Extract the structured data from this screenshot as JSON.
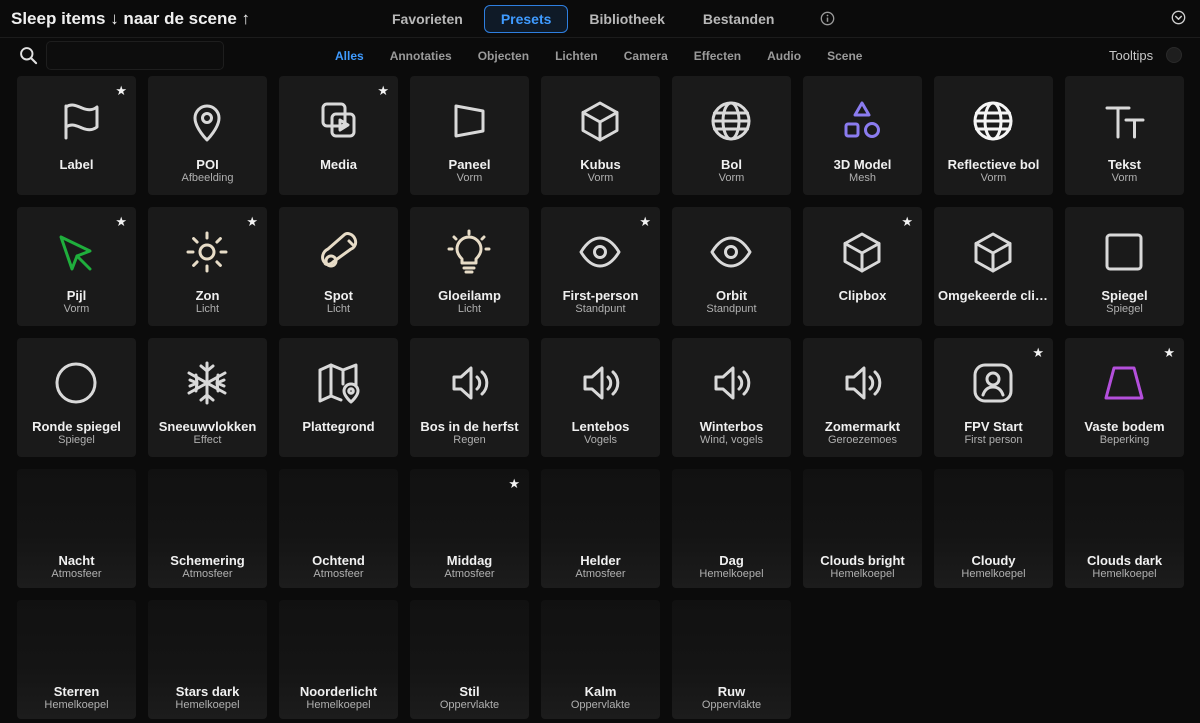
{
  "header": {
    "title": "Sleep items ↓ naar de scene ↑",
    "tabs": [
      {
        "label": "Favorieten",
        "active": false
      },
      {
        "label": "Presets",
        "active": true
      },
      {
        "label": "Bibliotheek",
        "active": false
      },
      {
        "label": "Bestanden",
        "active": false
      }
    ]
  },
  "search": {
    "value": "",
    "placeholder": ""
  },
  "filters": [
    {
      "label": "Alles",
      "active": true
    },
    {
      "label": "Annotaties",
      "active": false
    },
    {
      "label": "Objecten",
      "active": false
    },
    {
      "label": "Lichten",
      "active": false
    },
    {
      "label": "Camera",
      "active": false
    },
    {
      "label": "Effecten",
      "active": false
    },
    {
      "label": "Audio",
      "active": false
    },
    {
      "label": "Scene",
      "active": false
    }
  ],
  "tooltips": {
    "label": "Tooltips",
    "enabled": false
  },
  "colors": {
    "accent": "#3f9bff",
    "icon": "#d9d9d9",
    "purple": "#8b7cf0",
    "green": "#1fae3c",
    "beige": "#e7dcc7",
    "magenta": "#b44fdc"
  },
  "presets": [
    {
      "name": "Label",
      "sub": "",
      "icon": "flag-icon",
      "color": "#d9d9d9",
      "star": true
    },
    {
      "name": "POI",
      "sub": "Afbeelding",
      "icon": "map-pin-icon",
      "color": "#d9d9d9",
      "star": false
    },
    {
      "name": "Media",
      "sub": "",
      "icon": "media-icon",
      "color": "#d9d9d9",
      "star": true
    },
    {
      "name": "Paneel",
      "sub": "Vorm",
      "icon": "panel-icon",
      "color": "#d9d9d9",
      "star": false
    },
    {
      "name": "Kubus",
      "sub": "Vorm",
      "icon": "cube-icon",
      "color": "#d9d9d9",
      "star": false
    },
    {
      "name": "Bol",
      "sub": "Vorm",
      "icon": "globe-icon",
      "color": "#d9d9d9",
      "star": false
    },
    {
      "name": "3D Model",
      "sub": "Mesh",
      "icon": "shapes-icon",
      "color": "#8b7cf0",
      "star": false
    },
    {
      "name": "Reflectieve bol",
      "sub": "Vorm",
      "icon": "globe-icon",
      "color": "#f5f5f5",
      "star": false
    },
    {
      "name": "Tekst",
      "sub": "Vorm",
      "icon": "text-size-icon",
      "color": "#d9d9d9",
      "star": false
    },
    {
      "name": "Pijl",
      "sub": "Vorm",
      "icon": "cursor-arrow-icon",
      "color": "#1fae3c",
      "star": true
    },
    {
      "name": "Zon",
      "sub": "Licht",
      "icon": "sun-icon",
      "color": "#e7dcc7",
      "star": true
    },
    {
      "name": "Spot",
      "sub": "Licht",
      "icon": "spotlight-icon",
      "color": "#e7dcc7",
      "star": false
    },
    {
      "name": "Gloeilamp",
      "sub": "Licht",
      "icon": "bulb-icon",
      "color": "#e7dcc7",
      "star": false
    },
    {
      "name": "First-person",
      "sub": "Standpunt",
      "icon": "eye-icon",
      "color": "#d9d9d9",
      "star": true
    },
    {
      "name": "Orbit",
      "sub": "Standpunt",
      "icon": "eye-icon",
      "color": "#d9d9d9",
      "star": false
    },
    {
      "name": "Clipbox",
      "sub": "",
      "icon": "cube-icon",
      "color": "#d9d9d9",
      "star": true
    },
    {
      "name": "Omgekeerde clipbox",
      "sub": "",
      "icon": "cube-icon",
      "color": "#d9d9d9",
      "star": false
    },
    {
      "name": "Spiegel",
      "sub": "Spiegel",
      "icon": "square-icon",
      "color": "#d9d9d9",
      "star": false
    },
    {
      "name": "Ronde spiegel",
      "sub": "Spiegel",
      "icon": "circle-icon",
      "color": "#d9d9d9",
      "star": false
    },
    {
      "name": "Sneeuwvlokken",
      "sub": "Effect",
      "icon": "snowflake-icon",
      "color": "#d9d9d9",
      "star": false
    },
    {
      "name": "Plattegrond",
      "sub": "",
      "icon": "map-icon",
      "color": "#d9d9d9",
      "star": false
    },
    {
      "name": "Bos in de herfst",
      "sub": "Regen",
      "icon": "speaker-icon",
      "color": "#d9d9d9",
      "star": false
    },
    {
      "name": "Lentebos",
      "sub": "Vogels",
      "icon": "speaker-icon",
      "color": "#d9d9d9",
      "star": false
    },
    {
      "name": "Winterbos",
      "sub": "Wind, vogels",
      "icon": "speaker-icon",
      "color": "#d9d9d9",
      "star": false
    },
    {
      "name": "Zomermarkt",
      "sub": "Geroezemoes",
      "icon": "speaker-icon",
      "color": "#d9d9d9",
      "star": false
    },
    {
      "name": "FPV Start",
      "sub": "First person",
      "icon": "user-frame-icon",
      "color": "#d9d9d9",
      "star": true
    },
    {
      "name": "Vaste bodem",
      "sub": "Beperking",
      "icon": "trapezoid-icon",
      "color": "#b44fdc",
      "star": true
    },
    {
      "name": "Nacht",
      "sub": "Atmosfeer",
      "icon": "",
      "color": "",
      "star": false
    },
    {
      "name": "Schemering",
      "sub": "Atmosfeer",
      "icon": "",
      "color": "",
      "star": false
    },
    {
      "name": "Ochtend",
      "sub": "Atmosfeer",
      "icon": "",
      "color": "",
      "star": false
    },
    {
      "name": "Middag",
      "sub": "Atmosfeer",
      "icon": "",
      "color": "",
      "star": true
    },
    {
      "name": "Helder",
      "sub": "Atmosfeer",
      "icon": "",
      "color": "",
      "star": false
    },
    {
      "name": "Dag",
      "sub": "Hemelkoepel",
      "icon": "",
      "color": "",
      "star": false
    },
    {
      "name": "Clouds bright",
      "sub": "Hemelkoepel",
      "icon": "",
      "color": "",
      "star": false
    },
    {
      "name": "Cloudy",
      "sub": "Hemelkoepel",
      "icon": "",
      "color": "",
      "star": false
    },
    {
      "name": "Clouds dark",
      "sub": "Hemelkoepel",
      "icon": "",
      "color": "",
      "star": false
    },
    {
      "name": "Sterren",
      "sub": "Hemelkoepel",
      "icon": "",
      "color": "",
      "star": false
    },
    {
      "name": "Stars dark",
      "sub": "Hemelkoepel",
      "icon": "",
      "color": "",
      "star": false
    },
    {
      "name": "Noorderlicht",
      "sub": "Hemelkoepel",
      "icon": "",
      "color": "",
      "star": false
    },
    {
      "name": "Stil",
      "sub": "Oppervlakte",
      "icon": "",
      "color": "",
      "star": false
    },
    {
      "name": "Kalm",
      "sub": "Oppervlakte",
      "icon": "",
      "color": "",
      "star": false
    },
    {
      "name": "Ruw",
      "sub": "Oppervlakte",
      "icon": "",
      "color": "",
      "star": false
    }
  ]
}
